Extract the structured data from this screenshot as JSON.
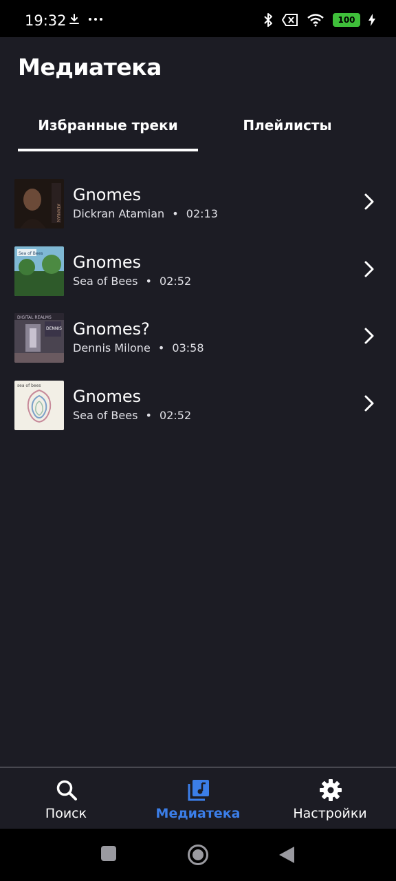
{
  "status_bar": {
    "time": "19:32",
    "battery": "100"
  },
  "page": {
    "title": "Медиатека"
  },
  "tabs": [
    {
      "label": "Избранные треки",
      "active": true
    },
    {
      "label": "Плейлисты",
      "active": false
    }
  ],
  "tracks": [
    {
      "title": "Gnomes",
      "artist": "Dickran Atamian",
      "duration": "02:13",
      "separator": "•"
    },
    {
      "title": "Gnomes",
      "artist": "Sea of Bees",
      "duration": "02:52",
      "separator": "•"
    },
    {
      "title": "Gnomes?",
      "artist": "Dennis Milone",
      "duration": "03:58",
      "separator": "•"
    },
    {
      "title": "Gnomes",
      "artist": "Sea of Bees",
      "duration": "02:52",
      "separator": "•"
    }
  ],
  "bottom_nav": {
    "items": [
      {
        "label": "Поиск",
        "icon": "search-icon",
        "active": false
      },
      {
        "label": "Медиатека",
        "icon": "music-library-icon",
        "active": true
      },
      {
        "label": "Настройки",
        "icon": "gear-icon",
        "active": false
      }
    ]
  },
  "colors": {
    "background": "#1c1c24",
    "accent": "#3b7ee8",
    "battery": "#3fbf3a"
  }
}
